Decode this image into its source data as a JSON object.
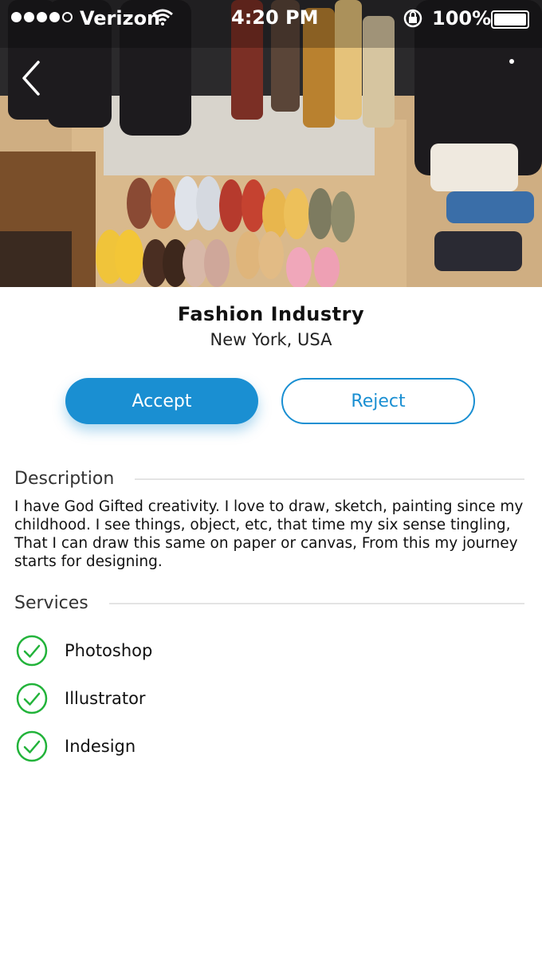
{
  "status_bar": {
    "carrier": "Verizon",
    "time": "4:20 PM",
    "battery": "100%"
  },
  "hero": {
    "image": "closet-shoes-and-bags-photo"
  },
  "profile": {
    "title": "Fashion Industry",
    "location": "New York, USA"
  },
  "actions": {
    "accept_label": "Accept",
    "reject_label": "Reject"
  },
  "description": {
    "heading": "Description",
    "text": "I have God Gifted creativity. I love to draw, sketch, painting since my childhood. I see things, object, etc, that time my six sense tingling, That I can draw this same on paper or canvas, From this my journey starts for designing."
  },
  "services": {
    "heading": "Services",
    "items": [
      {
        "label": "Photoshop"
      },
      {
        "label": "Illustrator"
      },
      {
        "label": "Indesign"
      }
    ]
  },
  "colors": {
    "accent": "#1a8fd2",
    "check": "#22b33a"
  }
}
